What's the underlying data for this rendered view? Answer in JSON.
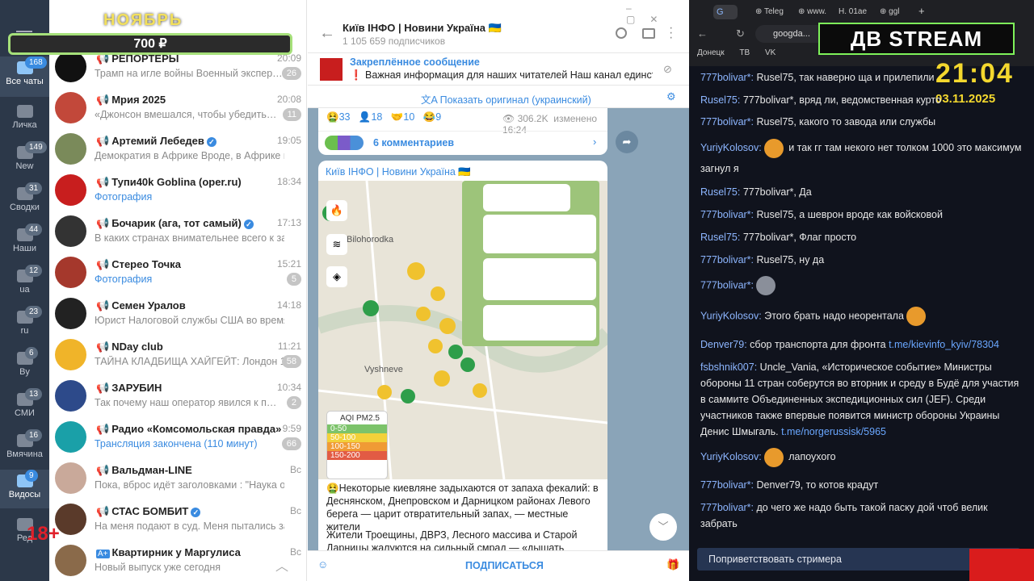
{
  "promo": {
    "month": "НОЯБРЬ",
    "price": "700 ₽"
  },
  "age_badge": "18+",
  "folders": [
    {
      "label": "Все чаты",
      "badge": "168"
    },
    {
      "label": "Личка",
      "badge": ""
    },
    {
      "label": "New",
      "badge": "149"
    },
    {
      "label": "Сводки",
      "badge": "31"
    },
    {
      "label": "Наши",
      "badge": "44"
    },
    {
      "label": "ua",
      "badge": "12"
    },
    {
      "label": "ru",
      "badge": "23"
    },
    {
      "label": "By",
      "badge": "6"
    },
    {
      "label": "СМИ",
      "badge": "13"
    },
    {
      "label": "Вмячина",
      "badge": "16"
    },
    {
      "label": "Видосы",
      "badge": "9"
    },
    {
      "label": "Ред",
      "badge": ""
    }
  ],
  "chats": [
    {
      "name": "РЕПОРТЕРЫ",
      "time": "20:09",
      "preview": "Трамп на игле войны Военный экспер…",
      "unread": "26",
      "verified": false,
      "media": false
    },
    {
      "name": "Мрия 2025",
      "time": "20:08",
      "preview": "«Джонсон вмешался, чтобы убедить…",
      "unread": "11",
      "verified": false,
      "media": false
    },
    {
      "name": "Артемий Лебедев",
      "time": "19:05",
      "preview": "Демократия в Африке Вроде, в Африке полная …",
      "unread": "",
      "verified": true,
      "media": false
    },
    {
      "name": "Тупи40k Goblina (oper.ru)",
      "time": "18:34",
      "preview": "Фотография",
      "unread": "",
      "verified": false,
      "media": true
    },
    {
      "name": "Бочарик (ага, тот самый)",
      "time": "17:13",
      "preview": "В каких странах внимательнее всего к заяв…",
      "unread": "",
      "verified": true,
      "media": false
    },
    {
      "name": "Стерео Точка",
      "time": "15:21",
      "preview": "Фотография",
      "unread": "5",
      "verified": false,
      "media": true
    },
    {
      "name": "Семен Уралов",
      "time": "14:18",
      "preview": "Юрист Налоговой службы США во время …",
      "unread": "",
      "verified": false,
      "media": false
    },
    {
      "name": "NDay club",
      "time": "11:21",
      "preview": "ТАЙНА КЛАДБИЩА ХАЙГЕЙТ: Лондон 19…",
      "unread": "58",
      "verified": false,
      "media": false
    },
    {
      "name": "ЗАРУБИН",
      "time": "10:34",
      "preview": "Так почему наш оператор явился к п…",
      "unread": "2",
      "verified": false,
      "media": false
    },
    {
      "name": "Радио «Комсомольская правда»",
      "time": "9:59",
      "preview": "Трансляция закончена (110 минут)",
      "unread": "66",
      "verified": false,
      "media": true
    },
    {
      "name": "Вальдман-LINE",
      "time": "Вс",
      "preview": "Пока, вброс идёт заголовками : \"Наука объяс…",
      "unread": "",
      "verified": false,
      "media": false
    },
    {
      "name": "СТАС БОМБИТ",
      "time": "Вс",
      "preview": "На меня подают в суд. Меня пытались заст…",
      "unread": "",
      "verified": true,
      "media": false
    },
    {
      "name": "Квартирник у Маргулиса",
      "time": "Вс",
      "preview": "Новый выпуск уже сегодня",
      "unread": "",
      "verified": false,
      "media": false
    }
  ],
  "channel": {
    "title": "Київ ІНФО | Новини Україна 🇺🇦",
    "subscribers": "1 105 659 подписчиков",
    "pinned_title": "Закреплённое сообщение",
    "pinned_text": "❗ Важная информация для наших читателей   Наш канал единствен…",
    "translate": "Показать оригинал (украинский)",
    "reactions": [
      "33",
      "18",
      "10",
      "9"
    ],
    "views": "306.2K",
    "edited": "изменено 16:24",
    "comments": "6 комментариев",
    "post_author": "Київ ІНФО | Новини Україна 🇺🇦",
    "post_text_1": "🤮Некоторые киевляне задыхаются от запаха фекалий: в Деснянском, Днепровском и Дарницком районах Левого берега — царит отвратительный запах, — местные жители",
    "post_text_2": "Жители Троещины, ДВРЗ, Лесного массива и Старой Дарницы жалуются на сильный смрад — «дышать невозможно».",
    "subscribe": "ПОДПИСАТЬСЯ",
    "map_labels": {
      "place1": "Vyshneve",
      "place2": "Bilohorodka",
      "aqi": "AQI PM2.5"
    },
    "aqi_rows": [
      "0-50",
      "50-100",
      "100-150",
      "150-200"
    ]
  },
  "browser": {
    "tabs": [
      "Teleg",
      "www.",
      "01ae",
      "ggl"
    ],
    "address": "googda...",
    "bookmarks": [
      "Донецк",
      "ТВ",
      "VK"
    ],
    "logo": "ДВ STREAM",
    "clock": "21:04",
    "date": "03.11.2025"
  },
  "chat_messages": [
    {
      "user": "777bolivar*:",
      "text": " Rusel75, так наверно ща и прилепили"
    },
    {
      "user": "Rusel75:",
      "text": " 777bolivar*, вряд ли, ведомственная курто"
    },
    {
      "user": "777bolivar*:",
      "text": " Rusel75, какого то завода или службы"
    },
    {
      "user": "YuriyKolosov:",
      "text": " и так гг там некого нет толком 1000 это максимум загнул я"
    },
    {
      "user": "Rusel75:",
      "text": " 777bolivar*, Да"
    },
    {
      "user": "777bolivar*:",
      "text": " Rusel75, а шеврон вроде как войсковой"
    },
    {
      "user": "Rusel75:",
      "text": " 777bolivar*, Флаг просто"
    },
    {
      "user": "777bolivar*:",
      "text": " Rusel75, ну да"
    },
    {
      "user": "777bolivar*:",
      "text": ""
    },
    {
      "user": "YuriyKolosov:",
      "text": " Этого брать надо неорентала"
    },
    {
      "user": "Denver79:",
      "text": " сбор транспорта для фронта ",
      "link": "t.me/kievinfo_kyiv/78304"
    },
    {
      "user": "fsbshnik007:",
      "text": " Uncle_Vania, «Историческое событие» Министры обороны 11 стран соберутся во вторник и среду в Будё для участия в саммите Объединенных экспедиционных сил (JEF). Среди участников также впервые появится министр обороны Украины Денис Шмыгаль. ",
      "link": "t.me/norgerussisk/5965"
    },
    {
      "user": "YuriyKolosov:",
      "text": " лапоухого"
    },
    {
      "user": "777bolivar*:",
      "text": " Denver79, то котов крадут"
    },
    {
      "user": "777bolivar*:",
      "text": " до чего же надо быть такой паску дой чтоб велик забрать"
    }
  ],
  "welcome": "Поприветствовать стримера",
  "colors": {
    "accent": "#3a8be0",
    "stream_bg": "#10131d",
    "user": "#8db6ff"
  }
}
